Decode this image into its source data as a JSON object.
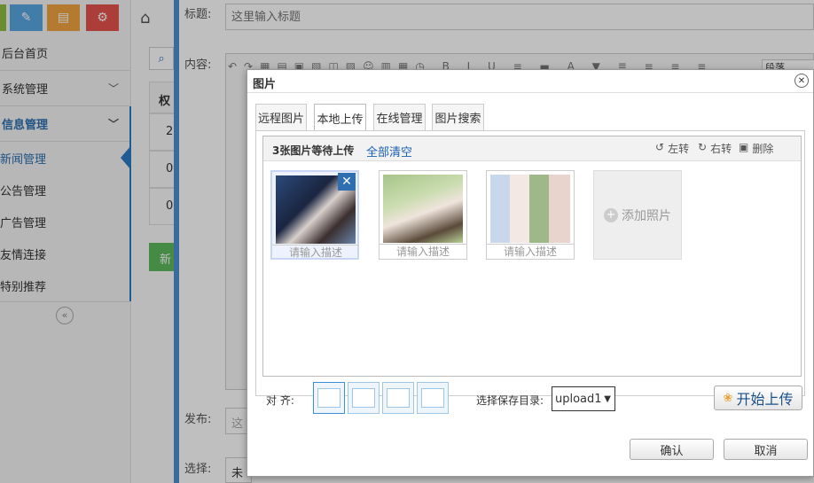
{
  "sidebar": {
    "toolbar": [
      {
        "icon": "grid-icon",
        "color": "#8dbd40"
      },
      {
        "icon": "pencil-icon",
        "color": "#59a6e0"
      },
      {
        "icon": "book-icon",
        "color": "#f0a540"
      },
      {
        "icon": "gears-icon",
        "color": "#e5534b"
      }
    ],
    "home": "后台首页",
    "system": "系统管理",
    "info": "信息管理",
    "subitems": [
      "新闻管理",
      "公告管理",
      "广告管理",
      "友情连接",
      "特别推荐"
    ]
  },
  "form": {
    "title_label": "标题:",
    "title_placeholder": "这里输入标题",
    "content_label": "内容:",
    "paragraph_select": "段落",
    "publish_label": "发布:",
    "publish_value": "这",
    "select_label": "选择:",
    "select_value": "未",
    "mid_col_header": "权",
    "mid_col_values": [
      "2",
      "0",
      "0"
    ],
    "mid_button": "新"
  },
  "dialog": {
    "title": "图片",
    "tabs": [
      "远程图片",
      "本地上传",
      "在线管理",
      "图片搜索"
    ],
    "active_tab": "本地上传",
    "status": "3张图片等待上传",
    "clear_all": "全部清空",
    "rotate_left": "左转",
    "rotate_right": "右转",
    "delete": "删除",
    "caption_placeholder": "请输入描述",
    "add_photo": "添加照片",
    "align_label": "对  齐:",
    "save_dir_label": "选择保存目录:",
    "save_dir_value": "upload1",
    "start_upload": "开始上传",
    "ok": "确认",
    "cancel": "取消"
  }
}
